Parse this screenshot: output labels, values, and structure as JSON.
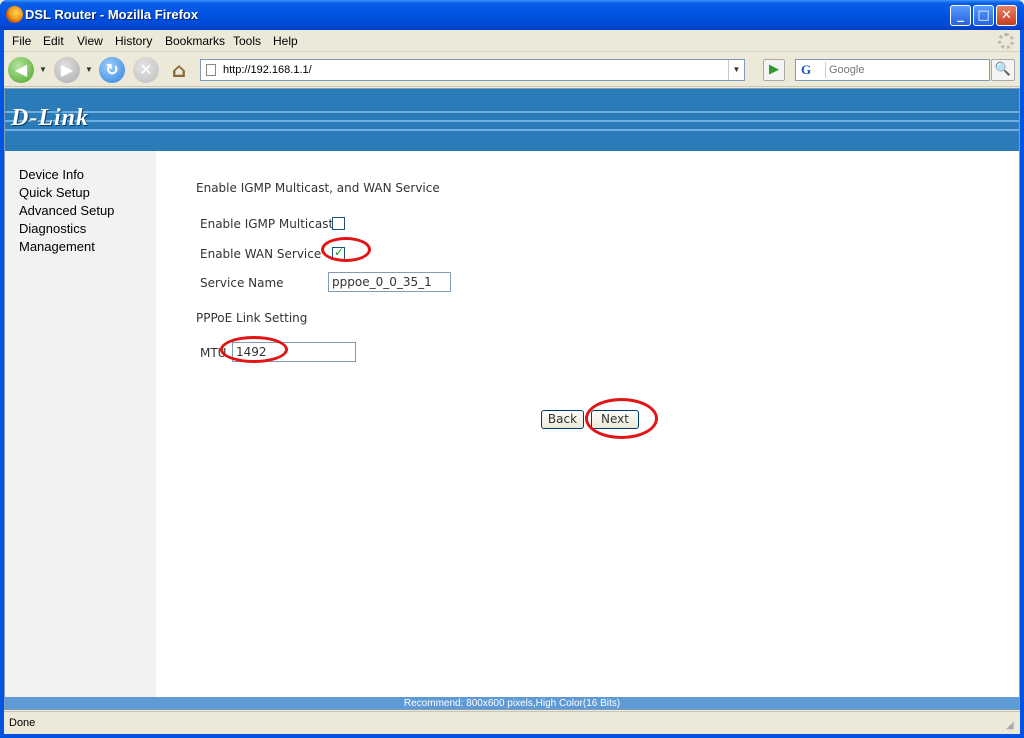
{
  "window": {
    "title": "DSL Router - Mozilla Firefox",
    "minimize": "_",
    "maximize": "□",
    "close": "✕"
  },
  "menu": {
    "file": "File",
    "edit": "Edit",
    "view": "View",
    "history": "History",
    "bookmarks": "Bookmarks",
    "tools": "Tools",
    "help": "Help"
  },
  "nav": {
    "url": "http://192.168.1.1/",
    "search_placeholder": "Google",
    "back_icon": "◀",
    "forward_icon": "▶",
    "reload_icon": "↻",
    "stop_icon": "✕",
    "home_icon": "⌂",
    "go_icon": "▶",
    "search_engine": "G",
    "search_icon": "🔍"
  },
  "page": {
    "logo": "D-Link",
    "sidebar": [
      "Device Info",
      "Quick Setup",
      "Advanced Setup",
      "Diagnostics",
      "Management"
    ],
    "heading1": "Enable IGMP Multicast, and WAN Service",
    "igmp_label": "Enable IGMP Multicast",
    "igmp_checked": false,
    "wan_label": "Enable WAN Service",
    "wan_checked": true,
    "service_name_label": "Service Name",
    "service_name_value": "pppoe_0_0_35_1",
    "heading2": "PPPoE Link Setting",
    "mtu_label": "MTU",
    "mtu_value": "1492",
    "back_button": "Back",
    "next_button": "Next",
    "recommend": "Recommend: 800x600 pixels,High Color(16 Bits)"
  },
  "status": {
    "text": "Done"
  },
  "colors": {
    "banner": "#2a7bb8",
    "annotation": "#e21414"
  }
}
